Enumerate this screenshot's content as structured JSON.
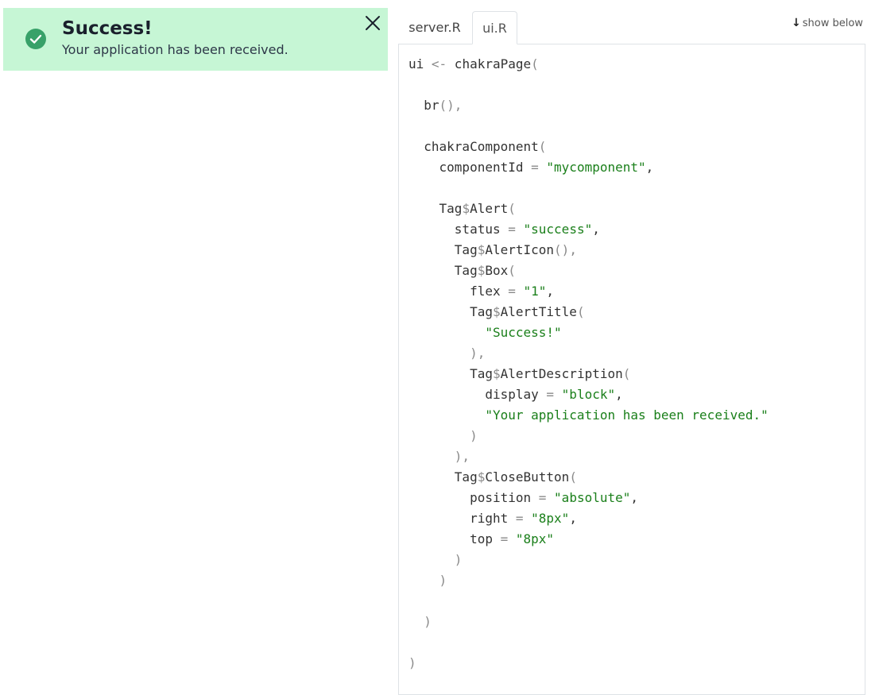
{
  "alert": {
    "title": "Success!",
    "description": "Your application has been received.",
    "status_color": "#c6f6d5",
    "icon": "check-circle-icon",
    "close_icon": "close-icon"
  },
  "tabs": [
    {
      "label": "server.R",
      "active": false
    },
    {
      "label": "ui.R",
      "active": true
    }
  ],
  "show_below": {
    "icon": "arrow-down-icon",
    "label": "show below"
  },
  "code_lines": [
    [
      {
        "t": "ui "
      },
      {
        "t": "<-",
        "c": "op"
      },
      {
        "t": " chakraPage"
      },
      {
        "t": "(",
        "c": "op"
      }
    ],
    [],
    [
      {
        "t": "  br"
      },
      {
        "t": "(),",
        "c": "op"
      }
    ],
    [],
    [
      {
        "t": "  chakraComponent"
      },
      {
        "t": "(",
        "c": "op"
      }
    ],
    [
      {
        "t": "    componentId "
      },
      {
        "t": "=",
        "c": "op"
      },
      {
        "t": " "
      },
      {
        "t": "\"mycomponent\"",
        "c": "str"
      },
      {
        "t": ","
      }
    ],
    [],
    [
      {
        "t": "    Tag"
      },
      {
        "t": "$",
        "c": "dol"
      },
      {
        "t": "Alert"
      },
      {
        "t": "(",
        "c": "op"
      }
    ],
    [
      {
        "t": "      status "
      },
      {
        "t": "=",
        "c": "op"
      },
      {
        "t": " "
      },
      {
        "t": "\"success\"",
        "c": "str"
      },
      {
        "t": ","
      }
    ],
    [
      {
        "t": "      Tag"
      },
      {
        "t": "$",
        "c": "dol"
      },
      {
        "t": "AlertIcon"
      },
      {
        "t": "(),",
        "c": "op"
      }
    ],
    [
      {
        "t": "      Tag"
      },
      {
        "t": "$",
        "c": "dol"
      },
      {
        "t": "Box"
      },
      {
        "t": "(",
        "c": "op"
      }
    ],
    [
      {
        "t": "        flex "
      },
      {
        "t": "=",
        "c": "op"
      },
      {
        "t": " "
      },
      {
        "t": "\"1\"",
        "c": "str"
      },
      {
        "t": ","
      }
    ],
    [
      {
        "t": "        Tag"
      },
      {
        "t": "$",
        "c": "dol"
      },
      {
        "t": "AlertTitle"
      },
      {
        "t": "(",
        "c": "op"
      }
    ],
    [
      {
        "t": "          "
      },
      {
        "t": "\"Success!\"",
        "c": "str"
      }
    ],
    [
      {
        "t": "        "
      },
      {
        "t": "),",
        "c": "op"
      }
    ],
    [
      {
        "t": "        Tag"
      },
      {
        "t": "$",
        "c": "dol"
      },
      {
        "t": "AlertDescription"
      },
      {
        "t": "(",
        "c": "op"
      }
    ],
    [
      {
        "t": "          display "
      },
      {
        "t": "=",
        "c": "op"
      },
      {
        "t": " "
      },
      {
        "t": "\"block\"",
        "c": "str"
      },
      {
        "t": ","
      }
    ],
    [
      {
        "t": "          "
      },
      {
        "t": "\"Your application has been received.\"",
        "c": "str"
      }
    ],
    [
      {
        "t": "        "
      },
      {
        "t": ")",
        "c": "op"
      }
    ],
    [
      {
        "t": "      "
      },
      {
        "t": "),",
        "c": "op"
      }
    ],
    [
      {
        "t": "      Tag"
      },
      {
        "t": "$",
        "c": "dol"
      },
      {
        "t": "CloseButton"
      },
      {
        "t": "(",
        "c": "op"
      }
    ],
    [
      {
        "t": "        position "
      },
      {
        "t": "=",
        "c": "op"
      },
      {
        "t": " "
      },
      {
        "t": "\"absolute\"",
        "c": "str"
      },
      {
        "t": ","
      }
    ],
    [
      {
        "t": "        right "
      },
      {
        "t": "=",
        "c": "op"
      },
      {
        "t": " "
      },
      {
        "t": "\"8px\"",
        "c": "str"
      },
      {
        "t": ","
      }
    ],
    [
      {
        "t": "        top "
      },
      {
        "t": "=",
        "c": "op"
      },
      {
        "t": " "
      },
      {
        "t": "\"8px\"",
        "c": "str"
      }
    ],
    [
      {
        "t": "      "
      },
      {
        "t": ")",
        "c": "op"
      }
    ],
    [
      {
        "t": "    "
      },
      {
        "t": ")",
        "c": "op"
      }
    ],
    [],
    [
      {
        "t": "  "
      },
      {
        "t": ")",
        "c": "op"
      }
    ],
    [],
    [
      {
        "t": ")",
        "c": "op"
      }
    ]
  ]
}
